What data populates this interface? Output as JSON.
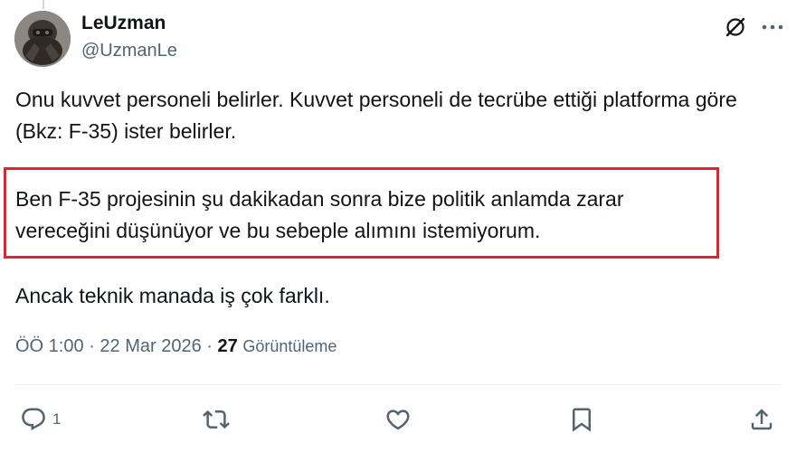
{
  "author": {
    "display_name": "LeUzman",
    "handle": "@UzmanLe"
  },
  "header_icons": {
    "grok": "grok-slash-icon",
    "more": "more-dots-icon"
  },
  "tweet": {
    "paragraph_1": "Onu kuvvet personeli belirler. Kuvvet personeli de tecrübe ettiği platforma göre (Bkz: F-35) ister belirler.",
    "paragraph_2": "Ben F-35 projesinin şu dakikadan sonra bize politik anlamda zarar vereceğini düşünüyor ve bu sebeple alımını istemiyorum.",
    "paragraph_3": "Ancak teknik manada iş çok farklı."
  },
  "highlight_color": "#e0232e",
  "meta": {
    "time": "ÖÖ 1:00",
    "separator_1": "·",
    "date": "22 Mar 2026",
    "separator_2": "·",
    "views_count": "27",
    "views_label": "Görüntüleme"
  },
  "actions": {
    "reply_icon": "reply-icon",
    "reply_count": "1",
    "retweet_icon": "retweet-icon",
    "like_icon": "heart-icon",
    "bookmark_icon": "bookmark-icon",
    "share_icon": "share-icon"
  },
  "colors": {
    "text": "#0f1419",
    "secondary": "#536471",
    "divider": "#eff3f4"
  }
}
